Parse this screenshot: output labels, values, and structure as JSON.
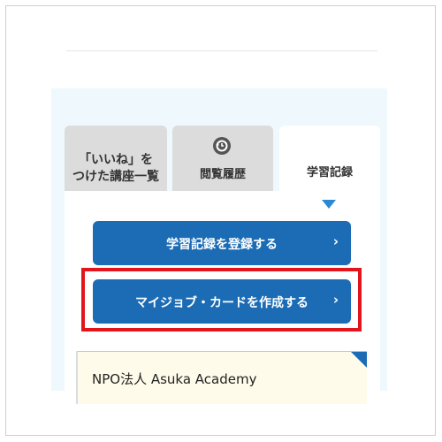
{
  "tabs": {
    "liked": {
      "label_line1": "「いいね」を",
      "label_line2": "つけた講座一覧"
    },
    "history": {
      "label": "閲覧履歴",
      "icon": "history-icon"
    },
    "record": {
      "label": "学習記録",
      "active": true
    }
  },
  "actions": {
    "register_label": "学習記録を登録する",
    "create_card_label": "マイジョブ・カードを作成する",
    "chevron": "›"
  },
  "org_card": {
    "name": "NPO法人 Asuka Academy"
  },
  "colors": {
    "button": "#1b6cb5",
    "highlight": "#e3151c",
    "panel": "#eef8fd"
  }
}
